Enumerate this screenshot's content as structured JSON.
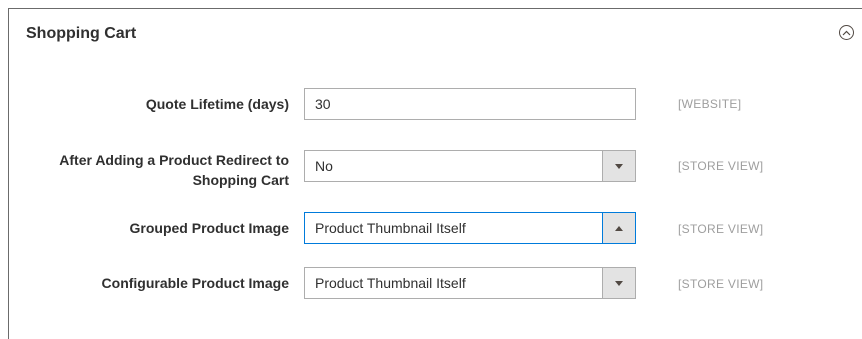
{
  "section": {
    "title": "Shopping Cart"
  },
  "fields": [
    {
      "label": "Quote Lifetime (days)",
      "value": "30",
      "scope": "[WEBSITE]"
    },
    {
      "label": "After Adding a Product Redirect to Shopping Cart",
      "value": "No",
      "scope": "[STORE VIEW]"
    },
    {
      "label": "Grouped Product Image",
      "value": "Product Thumbnail Itself",
      "scope": "[STORE VIEW]",
      "state": "open"
    },
    {
      "label": "Configurable Product Image",
      "value": "Product Thumbnail Itself",
      "scope": "[STORE VIEW]"
    }
  ],
  "icons": {
    "collapse": "chevron-up-circle-icon",
    "dropdown": "triangle-down-icon",
    "dropdown_open": "triangle-up-icon"
  },
  "colors": {
    "focus_border": "#007bdb",
    "field_border": "#adadad",
    "arrow_bg": "#e3e3e3",
    "scope_text": "#9e9e9e"
  }
}
